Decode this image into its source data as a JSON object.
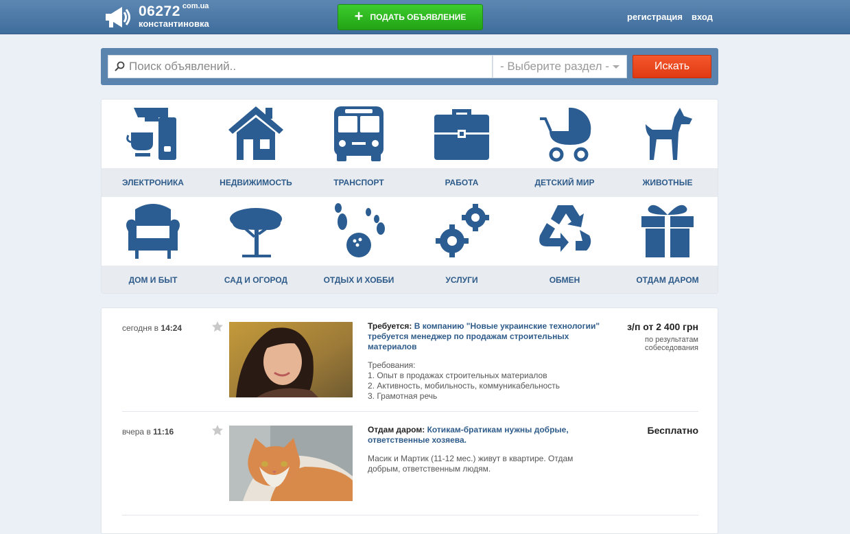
{
  "header": {
    "logo_number": "06272",
    "logo_domain": "com.ua",
    "logo_city": "константиновка",
    "post_button": "ПОДАТЬ ОБЪЯВЛЕНИЕ",
    "register_link": "регистрация",
    "login_link": "вход"
  },
  "search": {
    "placeholder": "Поиск объявлений..",
    "section_select": "- Выберите раздел -",
    "button": "Искать"
  },
  "categories": [
    {
      "label": "ЭЛЕКТРОНИКА",
      "icon": "coffee-maker-icon"
    },
    {
      "label": "НЕДВИЖИМОСТЬ",
      "icon": "house-icon"
    },
    {
      "label": "ТРАНСПОРТ",
      "icon": "bus-icon"
    },
    {
      "label": "РАБОТА",
      "icon": "briefcase-icon"
    },
    {
      "label": "ДЕТСКИЙ МИР",
      "icon": "stroller-icon"
    },
    {
      "label": "ЖИВОТНЫЕ",
      "icon": "dog-icon"
    },
    {
      "label": "ДОМ И БЫТ",
      "icon": "armchair-icon"
    },
    {
      "label": "САД И ОГОРОД",
      "icon": "tree-icon"
    },
    {
      "label": "ОТДЫХ И ХОББИ",
      "icon": "bowling-icon"
    },
    {
      "label": "УСЛУГИ",
      "icon": "gears-icon"
    },
    {
      "label": "ОБМЕН",
      "icon": "recycle-icon"
    },
    {
      "label": "ОТДАМ ДАРОМ",
      "icon": "gift-icon"
    }
  ],
  "listings": [
    {
      "date_prefix": "сегодня в",
      "time": "14:24",
      "category": "Требуется:",
      "title": "В компанию \"Новые украинские технологии\" требуется менеджер по продажам строительных материалов",
      "desc": [
        "Требования:",
        "1. Опыт в продажах строительных материалов",
        "2. Активность, мобильность, коммуникабельность",
        "3. Грамотная речь"
      ],
      "price": "з/п от 2 400 грн",
      "price_note": "по результатам собеседования"
    },
    {
      "date_prefix": "вчера в",
      "time": "11:16",
      "category": "Отдам даром:",
      "title": "Котикам-братикам нужны добрые, ответственные хозяева.",
      "desc": [
        "Масик и Мартик (11-12 мес.) живут в квартире. Отдам добрым, ответственным людям."
      ],
      "price": "Бесплатно",
      "price_note": ""
    }
  ],
  "colors": {
    "header": "#4a76a4",
    "accent_green": "#2db320",
    "search_button": "#ee4a1f",
    "icon_blue": "#2c5d92"
  }
}
